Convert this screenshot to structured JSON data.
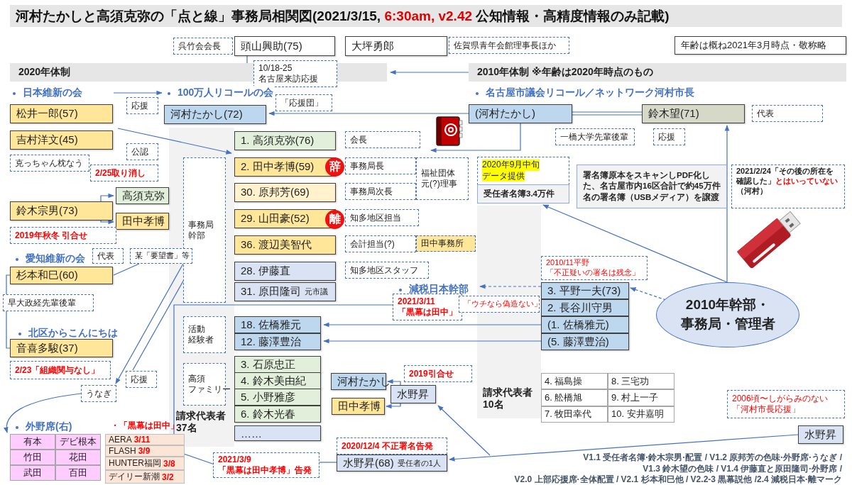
{
  "title": {
    "segments": [
      {
        "text": "河村たかしと高須克弥の「点と線」事務局相関図(2021/3/15, ",
        "emphasis": false
      },
      {
        "text": "6:30am, v2.42",
        "emphasis": true
      },
      {
        "text": " 公知情報・高精度情報のみ記載)",
        "emphasis": false
      }
    ]
  },
  "nodes": [
    {
      "kind": "note",
      "text": "呉竹会会長"
    },
    {
      "kind": "box",
      "text": "頭山興助(75)",
      "color": "#ffffff"
    },
    {
      "kind": "box",
      "text": "大坪勇郎",
      "color": "#ffffff"
    },
    {
      "kind": "note",
      "text": "佐賀県青年会館理事長ほか"
    },
    {
      "kind": "box",
      "text": "年齢は概ね2021年3月時点・敬称略",
      "color": "#ffffff"
    },
    {
      "kind": "header",
      "text": "2020年体制"
    },
    {
      "kind": "note",
      "lines": [
        "10/18-25",
        "名古屋来訪応援"
      ]
    },
    {
      "kind": "header",
      "text": "2010年体制 ※年齢は2020年時点のもの"
    },
    {
      "kind": "group",
      "text": "日本維新の会"
    },
    {
      "kind": "group",
      "text": "100万人リコールの会"
    },
    {
      "kind": "group",
      "text": "名古屋市議会リコール／ネットワーク河村市長"
    },
    {
      "kind": "note",
      "text": "応援"
    },
    {
      "kind": "note",
      "text": "「応援団」"
    },
    {
      "kind": "box",
      "text": "松井一郎(57)",
      "color": "#ffe699"
    },
    {
      "kind": "box",
      "text": "河村たかし(72)",
      "color": "#bdd7ee"
    },
    {
      "kind": "box",
      "text": "(河村たかし)",
      "color": "#bdd7ee"
    },
    {
      "kind": "box",
      "text": "鈴木望(71)",
      "color": "#d6d9c8"
    },
    {
      "kind": "note",
      "text": "代表"
    },
    {
      "kind": "box",
      "text": "吉村洋文(45)",
      "color": "#ffe699"
    },
    {
      "kind": "box",
      "text": "1. 高須克弥(76)",
      "color": "#e2efda"
    },
    {
      "kind": "note",
      "text": "会長"
    },
    {
      "kind": "note",
      "text": "一橋大学先輩後輩"
    },
    {
      "kind": "note",
      "text": "応援"
    },
    {
      "kind": "note",
      "text": "公認"
    },
    {
      "kind": "note",
      "text": "克っちゃん枕なう"
    },
    {
      "kind": "note",
      "text": "2/25取り消し",
      "alert": true,
      "strong": true
    },
    {
      "kind": "note",
      "lines": [
        "事務局",
        "幹部"
      ]
    },
    {
      "kind": "box",
      "text": "2. 田中孝博(59)",
      "color": "#ffe699"
    },
    {
      "kind": "badge",
      "text": "辞"
    },
    {
      "kind": "note",
      "text": "事務局長"
    },
    {
      "kind": "note",
      "lines": [
        "福祉団体",
        "元(?)理事"
      ]
    },
    {
      "kind": "highlight",
      "lines": [
        "2020年9月中旬",
        "データ提供"
      ]
    },
    {
      "kind": "box",
      "text": "鈴木宗男(73)",
      "color": "#ffe699"
    },
    {
      "kind": "box",
      "text": "高須克弥",
      "color": "#e2efda"
    },
    {
      "kind": "box",
      "text": "30. 原邦芳(69)",
      "color": "#fff2cc"
    },
    {
      "kind": "note",
      "text": "事務局次長"
    },
    {
      "kind": "info",
      "text": "受任者名簿3.4万件"
    },
    {
      "kind": "info",
      "text": "署名簿原本をスキャンしPDF化した、名古屋市内16区合計で約45万件名の署名簿（USBメディア）を譲渡"
    },
    {
      "kind": "note",
      "segments": [
        {
          "text": "2021/2/24「その後の所在を確認した」",
          "alert": false
        },
        {
          "text": "とはいっていない",
          "alert": true
        },
        {
          "text": "（河村）",
          "alert": false
        }
      ],
      "strong": true
    },
    {
      "kind": "box",
      "text": "田中孝博",
      "color": "#ffe699"
    },
    {
      "kind": "box",
      "text": "29. 山田豪(52)",
      "color": "#ffe699"
    },
    {
      "kind": "badge",
      "text": "離"
    },
    {
      "kind": "note",
      "text": "知多地区担当"
    },
    {
      "kind": "note",
      "text": "2019年秋冬 引合せ",
      "alert": true,
      "strong": true
    },
    {
      "kind": "box",
      "text": "36. 渡辺美智代",
      "color": "#ffe699"
    },
    {
      "kind": "note",
      "text": "会計担当(?)"
    },
    {
      "kind": "note",
      "text": "田中事務所",
      "color": "#ffe699"
    },
    {
      "kind": "group",
      "text": "愛知維新の会"
    },
    {
      "kind": "note",
      "text": "代表"
    },
    {
      "kind": "note",
      "text": "某「要望書」等"
    },
    {
      "kind": "box",
      "text": "杉本和巳(60)",
      "color": "#ffe699"
    },
    {
      "kind": "box",
      "text": "28. 伊藤直",
      "color": "#dae3f3"
    },
    {
      "kind": "note",
      "text": "知多地区スタッフ"
    },
    {
      "kind": "note",
      "lines": [
        "2010/11平野",
        "「不正疑いの署名は残念」"
      ],
      "alert": true
    },
    {
      "kind": "note",
      "text": "早大政経先輩後輩"
    },
    {
      "kind": "box",
      "text": "31. 原田隆司",
      "suffix": "元市議",
      "color": "#dae3f3"
    },
    {
      "kind": "group",
      "text": "減税日本幹部"
    },
    {
      "kind": "note",
      "lines": [
        "2021/3/11",
        "「黒幕は田中」"
      ],
      "alert": true,
      "strong": true
    },
    {
      "kind": "note",
      "text": "「ウチなら偽造ない」",
      "alert": true
    },
    {
      "kind": "box",
      "text": "3. 平野一夫(73)",
      "color": "#bdd7ee"
    },
    {
      "kind": "box",
      "text": "2. 長谷川守男",
      "color": "#bdd7ee"
    },
    {
      "kind": "group",
      "text": "北区からこんにちは"
    },
    {
      "kind": "note",
      "lines": [
        "活動",
        "経験者"
      ]
    },
    {
      "kind": "box",
      "text": "18. 佐橋雅元",
      "color": "#bdd7ee"
    },
    {
      "kind": "box",
      "text": "(1. 佐橋雅元)",
      "color": "#bdd7ee"
    },
    {
      "kind": "box",
      "text": "音喜多駿(37)",
      "color": "#ffe699"
    },
    {
      "kind": "box",
      "text": "12. 藤澤豊治",
      "color": "#bdd7ee"
    },
    {
      "kind": "box",
      "text": "(5. 藤澤豊治)",
      "color": "#bdd7ee"
    },
    {
      "kind": "ellipse",
      "lines": [
        "2010年幹部・",
        "事務局・管理者"
      ]
    },
    {
      "kind": "note",
      "text": "2/23「組織関与なし」",
      "alert": true,
      "strong": true
    },
    {
      "kind": "note",
      "text": "応援"
    },
    {
      "kind": "note",
      "lines": [
        "高須",
        "ファミリー"
      ]
    },
    {
      "kind": "box",
      "text": "3. 石原忠正",
      "color": "#e2efda"
    },
    {
      "kind": "box",
      "text": "4. 鈴木美由紀",
      "color": "#e2efda"
    },
    {
      "kind": "box",
      "text": "河村たかし",
      "color": "#bdd7ee"
    },
    {
      "kind": "note",
      "text": "2019引合せ",
      "alert": true,
      "strong": true
    },
    {
      "kind": "note",
      "text": "うなぎ"
    },
    {
      "kind": "label",
      "lines": [
        "請求代表者",
        "37名"
      ]
    },
    {
      "kind": "box",
      "text": "5. 小野雅彦",
      "color": "#e2efda"
    },
    {
      "kind": "box",
      "text": "6. 鈴木光春",
      "color": "#e2efda"
    },
    {
      "kind": "box",
      "text": "田中孝博",
      "color": "#ffe699"
    },
    {
      "kind": "box",
      "text": "水野昇",
      "color": "#dae3f3"
    },
    {
      "kind": "label",
      "lines": [
        "請求代表者",
        "10名"
      ]
    },
    {
      "kind": "grid",
      "color": "#ffffff",
      "cells": [
        "4. 福島操",
        "8. 三宅功",
        "6. 舩橋旭",
        "9. 村上一子",
        "7. 牧田幸代",
        "10. 安井嘉明"
      ]
    },
    {
      "kind": "note",
      "lines": [
        "2006頃〜しがらみのない",
        "「河村市長応援」"
      ],
      "alert": true
    },
    {
      "kind": "group",
      "text": "外野席(右)"
    },
    {
      "kind": "label",
      "lines": [
        "・「黒幕は田中」"
      ],
      "alert": true
    },
    {
      "kind": "grid",
      "color": "#ffccff",
      "cells": [
        "有本",
        "デビ根本",
        "竹田",
        "花田",
        "武田",
        "百田"
      ]
    },
    {
      "kind": "media",
      "items": [
        {
          "name": "AERA",
          "date": "3/11"
        },
        {
          "name": "FLASH",
          "date": "3/9"
        },
        {
          "name": "HUNTER福岡",
          "date": "3/8"
        },
        {
          "name": "デイリー新潮",
          "date": "3/2"
        }
      ]
    },
    {
      "kind": "box",
      "text": "……",
      "color": "#dae3f3"
    },
    {
      "kind": "note",
      "text": "2020/12/4 不正署名告発",
      "alert": true,
      "strong": true
    },
    {
      "kind": "box",
      "text": "水野昇",
      "color": "#dae3f3"
    },
    {
      "kind": "note",
      "lines": [
        "2021/3/9",
        "「黒幕は田中孝博」告発"
      ],
      "alert": true,
      "strong": true
    },
    {
      "kind": "box",
      "text": "水野昇(68)",
      "suffix": "受任者の1人",
      "color": "#dae3f3"
    },
    {
      "kind": "footer",
      "lines": [
        "V1.1 受任者名簿·鈴木宗男·配置 / V1.2 原邦芳の色味·外野席·うなぎ /",
        "V1.3 鈴木望の色味 / V1.4 伊藤直と原田隆司·外野席 /",
        "V2.0 上部応援席·全体配置 / V2.1 杉本和巳他 / V2.2-3 黒幕説他 /2.4 減税日本·離マーク"
      ]
    }
  ]
}
